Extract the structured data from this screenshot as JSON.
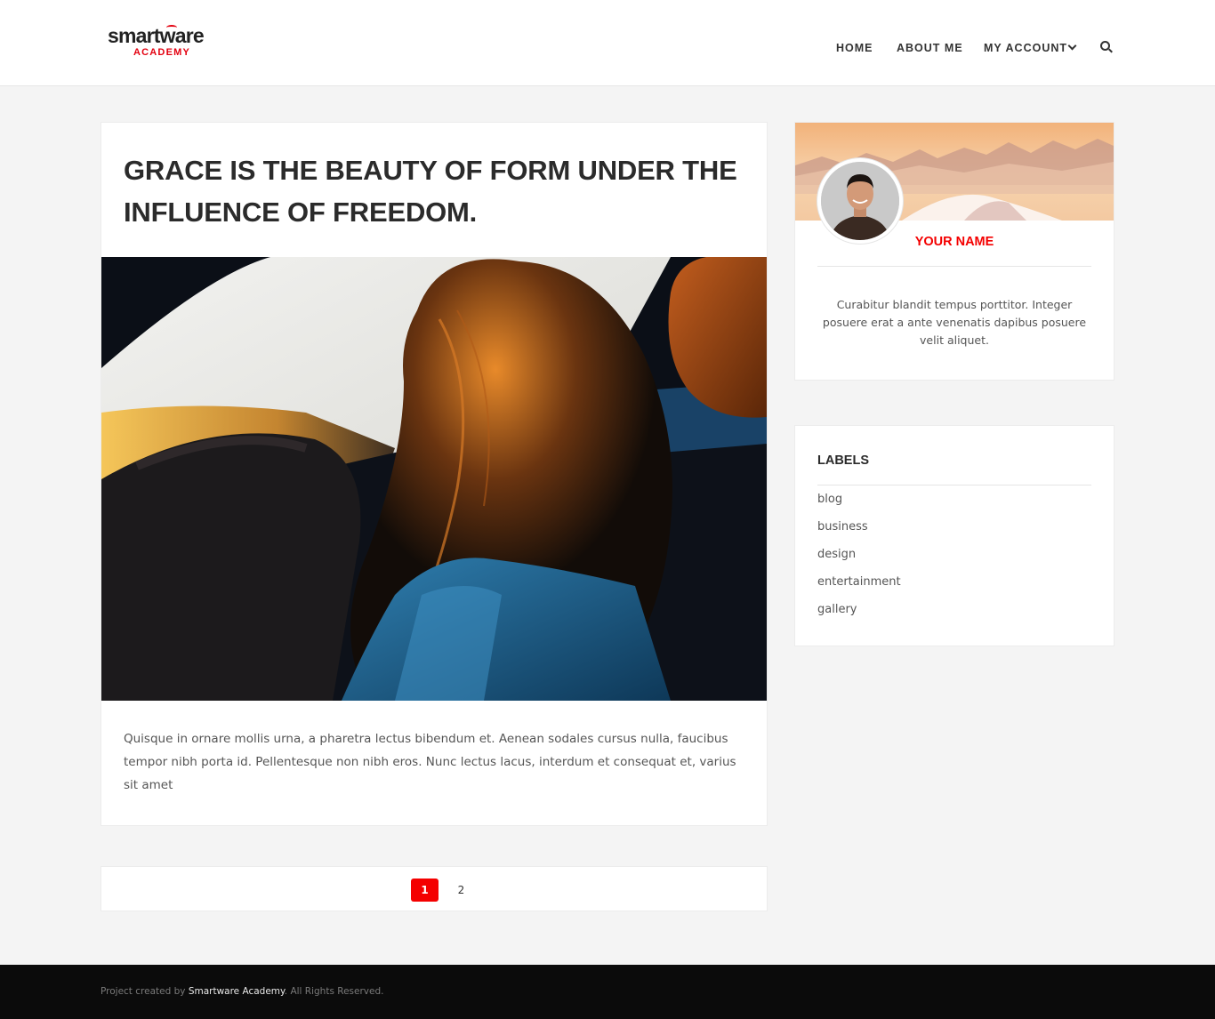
{
  "header": {
    "logo_main": "smartware",
    "logo_sub": "ACADEMY",
    "nav": {
      "home": "HOME",
      "about": "ABOUT ME",
      "account": "MY ACCOUNT"
    },
    "icons": [
      "chevron-down-icon",
      "search-icon"
    ]
  },
  "post": {
    "title": "GRACE IS THE BEAUTY OF FORM UNDER THE INFLUENCE OF FREEDOM.",
    "excerpt": "Quisque in ornare mollis urna, a pharetra lectus bibendum et. Aenean sodales cursus nulla, faucibus tempor nibh porta id. Pellentesque non nibh eros. Nunc lectus lacus, interdum et consequat et, varius sit amet"
  },
  "pagination": {
    "pages": [
      "1",
      "2"
    ],
    "active": "1"
  },
  "profile": {
    "name": "YOUR NAME",
    "description": "Curabitur blandit tempus porttitor. Integer posuere erat a ante venenatis dapibus posuere velit aliquet."
  },
  "labels": {
    "title": "LABELS",
    "items": [
      "blog",
      "business",
      "design",
      "entertainment",
      "gallery"
    ]
  },
  "footer": {
    "prefix": "Project created by ",
    "brand": "Smartware Academy",
    "suffix": ". All Rights Reserved."
  },
  "colors": {
    "accent": "#f40000",
    "footer_bg": "#0b0b0b",
    "page_bg": "#f4f4f4"
  }
}
